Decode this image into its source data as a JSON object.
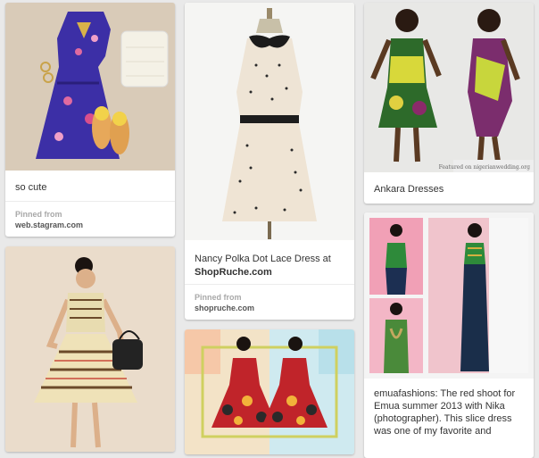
{
  "colors": {
    "background": "#e9e9e9",
    "card": "#ffffff",
    "pinned_label": "#a8a8a8"
  },
  "pins": [
    {
      "image_name": "blue floral dress flat-lay with yellow loafers and quilted bag",
      "description": "so cute",
      "pinned_from_label": "Pinned from",
      "source": "web.stagram.com"
    },
    {
      "image_name": "polka dot dress with black collar on dress form",
      "description_line1": "Nancy Polka Dot Lace Dress at",
      "description_link": "ShopRuche.com",
      "pinned_from_label": "Pinned from",
      "source": "shopruche.com"
    },
    {
      "image_name": "two women in ankara print dresses",
      "watermark": "Featured on  nigerianwedding.org",
      "description": "Ankara Dresses"
    },
    {
      "image_name": "woman in striped print dress holding black handbag"
    },
    {
      "image_name": "mirrored image of woman in red ankara dress"
    },
    {
      "image_name": "collage of woman in green and navy print gown",
      "description": "emuafashions: The red shoot for Emua summer 2013 with Nika (photographer). This slice dress was one of my favorite and"
    }
  ]
}
